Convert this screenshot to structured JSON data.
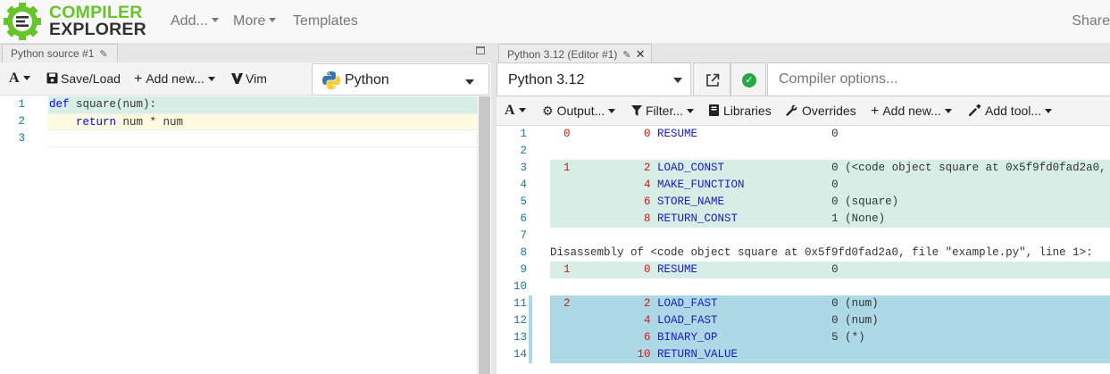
{
  "app": {
    "logo_line1": "COMPILER",
    "logo_line2": "EXPLORER",
    "nav": {
      "add": "Add...",
      "more": "More",
      "templates": "Templates",
      "share": "Share"
    }
  },
  "colors": {
    "brand_green": "#67c52a",
    "highlight_green": "#d6eee5",
    "highlight_blue": "#add8e6",
    "line_number": "#237893"
  },
  "source_pane": {
    "tab_title": "Python source #1",
    "toolbar": {
      "font_icon": "A",
      "save_load": "Save/Load",
      "add_new": "Add new...",
      "vim": "Vim"
    },
    "language": "Python",
    "lines": [
      {
        "num": "1",
        "kw": "def",
        "rest": " square(num):",
        "hl": "green"
      },
      {
        "num": "2",
        "kw": "    return",
        "rest": " num * num",
        "hl": "yellow"
      },
      {
        "num": "3",
        "kw": "",
        "rest": "",
        "hl": "none"
      }
    ]
  },
  "compiler_pane": {
    "tab_title": "Python 3.12 (Editor #1)",
    "compiler": "Python 3.12",
    "options_placeholder": "Compiler options...",
    "toolbar": {
      "output": "Output...",
      "filter": "Filter...",
      "libraries": "Libraries",
      "overrides": "Overrides",
      "add_new": "Add new...",
      "add_tool": "Add tool..."
    },
    "asm": [
      {
        "n": "1",
        "src": "0",
        "off": "0",
        "op": "RESUME",
        "arg": "0",
        "extra": "",
        "hl": "none"
      },
      {
        "n": "2",
        "src": "",
        "off": "",
        "op": "",
        "arg": "",
        "extra": "",
        "hl": "none"
      },
      {
        "n": "3",
        "src": "1",
        "off": "2",
        "op": "LOAD_CONST",
        "arg": "0",
        "extra": " (<code object square at 0x5f9fd0fad2a0,",
        "hl": "green"
      },
      {
        "n": "4",
        "src": "",
        "off": "4",
        "op": "MAKE_FUNCTION",
        "arg": "0",
        "extra": "",
        "hl": "green"
      },
      {
        "n": "5",
        "src": "",
        "off": "6",
        "op": "STORE_NAME",
        "arg": "0",
        "extra": " (square)",
        "hl": "green"
      },
      {
        "n": "6",
        "src": "",
        "off": "8",
        "op": "RETURN_CONST",
        "arg": "1",
        "extra": " (None)",
        "hl": "green"
      },
      {
        "n": "7",
        "src": "",
        "off": "",
        "op": "",
        "arg": "",
        "extra": "",
        "hl": "none"
      },
      {
        "n": "8",
        "text": "Disassembly of <code object square at 0x5f9fd0fad2a0, file \"example.py\", line 1>:",
        "hl": "none"
      },
      {
        "n": "9",
        "src": "1",
        "off": "0",
        "op": "RESUME",
        "arg": "0",
        "extra": "",
        "hl": "green"
      },
      {
        "n": "10",
        "src": "",
        "off": "",
        "op": "",
        "arg": "",
        "extra": "",
        "hl": "none"
      },
      {
        "n": "11",
        "src": "2",
        "off": "2",
        "op": "LOAD_FAST",
        "arg": "0",
        "extra": " (num)",
        "hl": "blue"
      },
      {
        "n": "12",
        "src": "",
        "off": "4",
        "op": "LOAD_FAST",
        "arg": "0",
        "extra": " (num)",
        "hl": "blue"
      },
      {
        "n": "13",
        "src": "",
        "off": "6",
        "op": "BINARY_OP",
        "arg": "5",
        "extra": " (*)",
        "hl": "blue"
      },
      {
        "n": "14",
        "src": "",
        "off": "10",
        "op": "RETURN_VALUE",
        "arg": "",
        "extra": "",
        "hl": "blue"
      }
    ]
  }
}
